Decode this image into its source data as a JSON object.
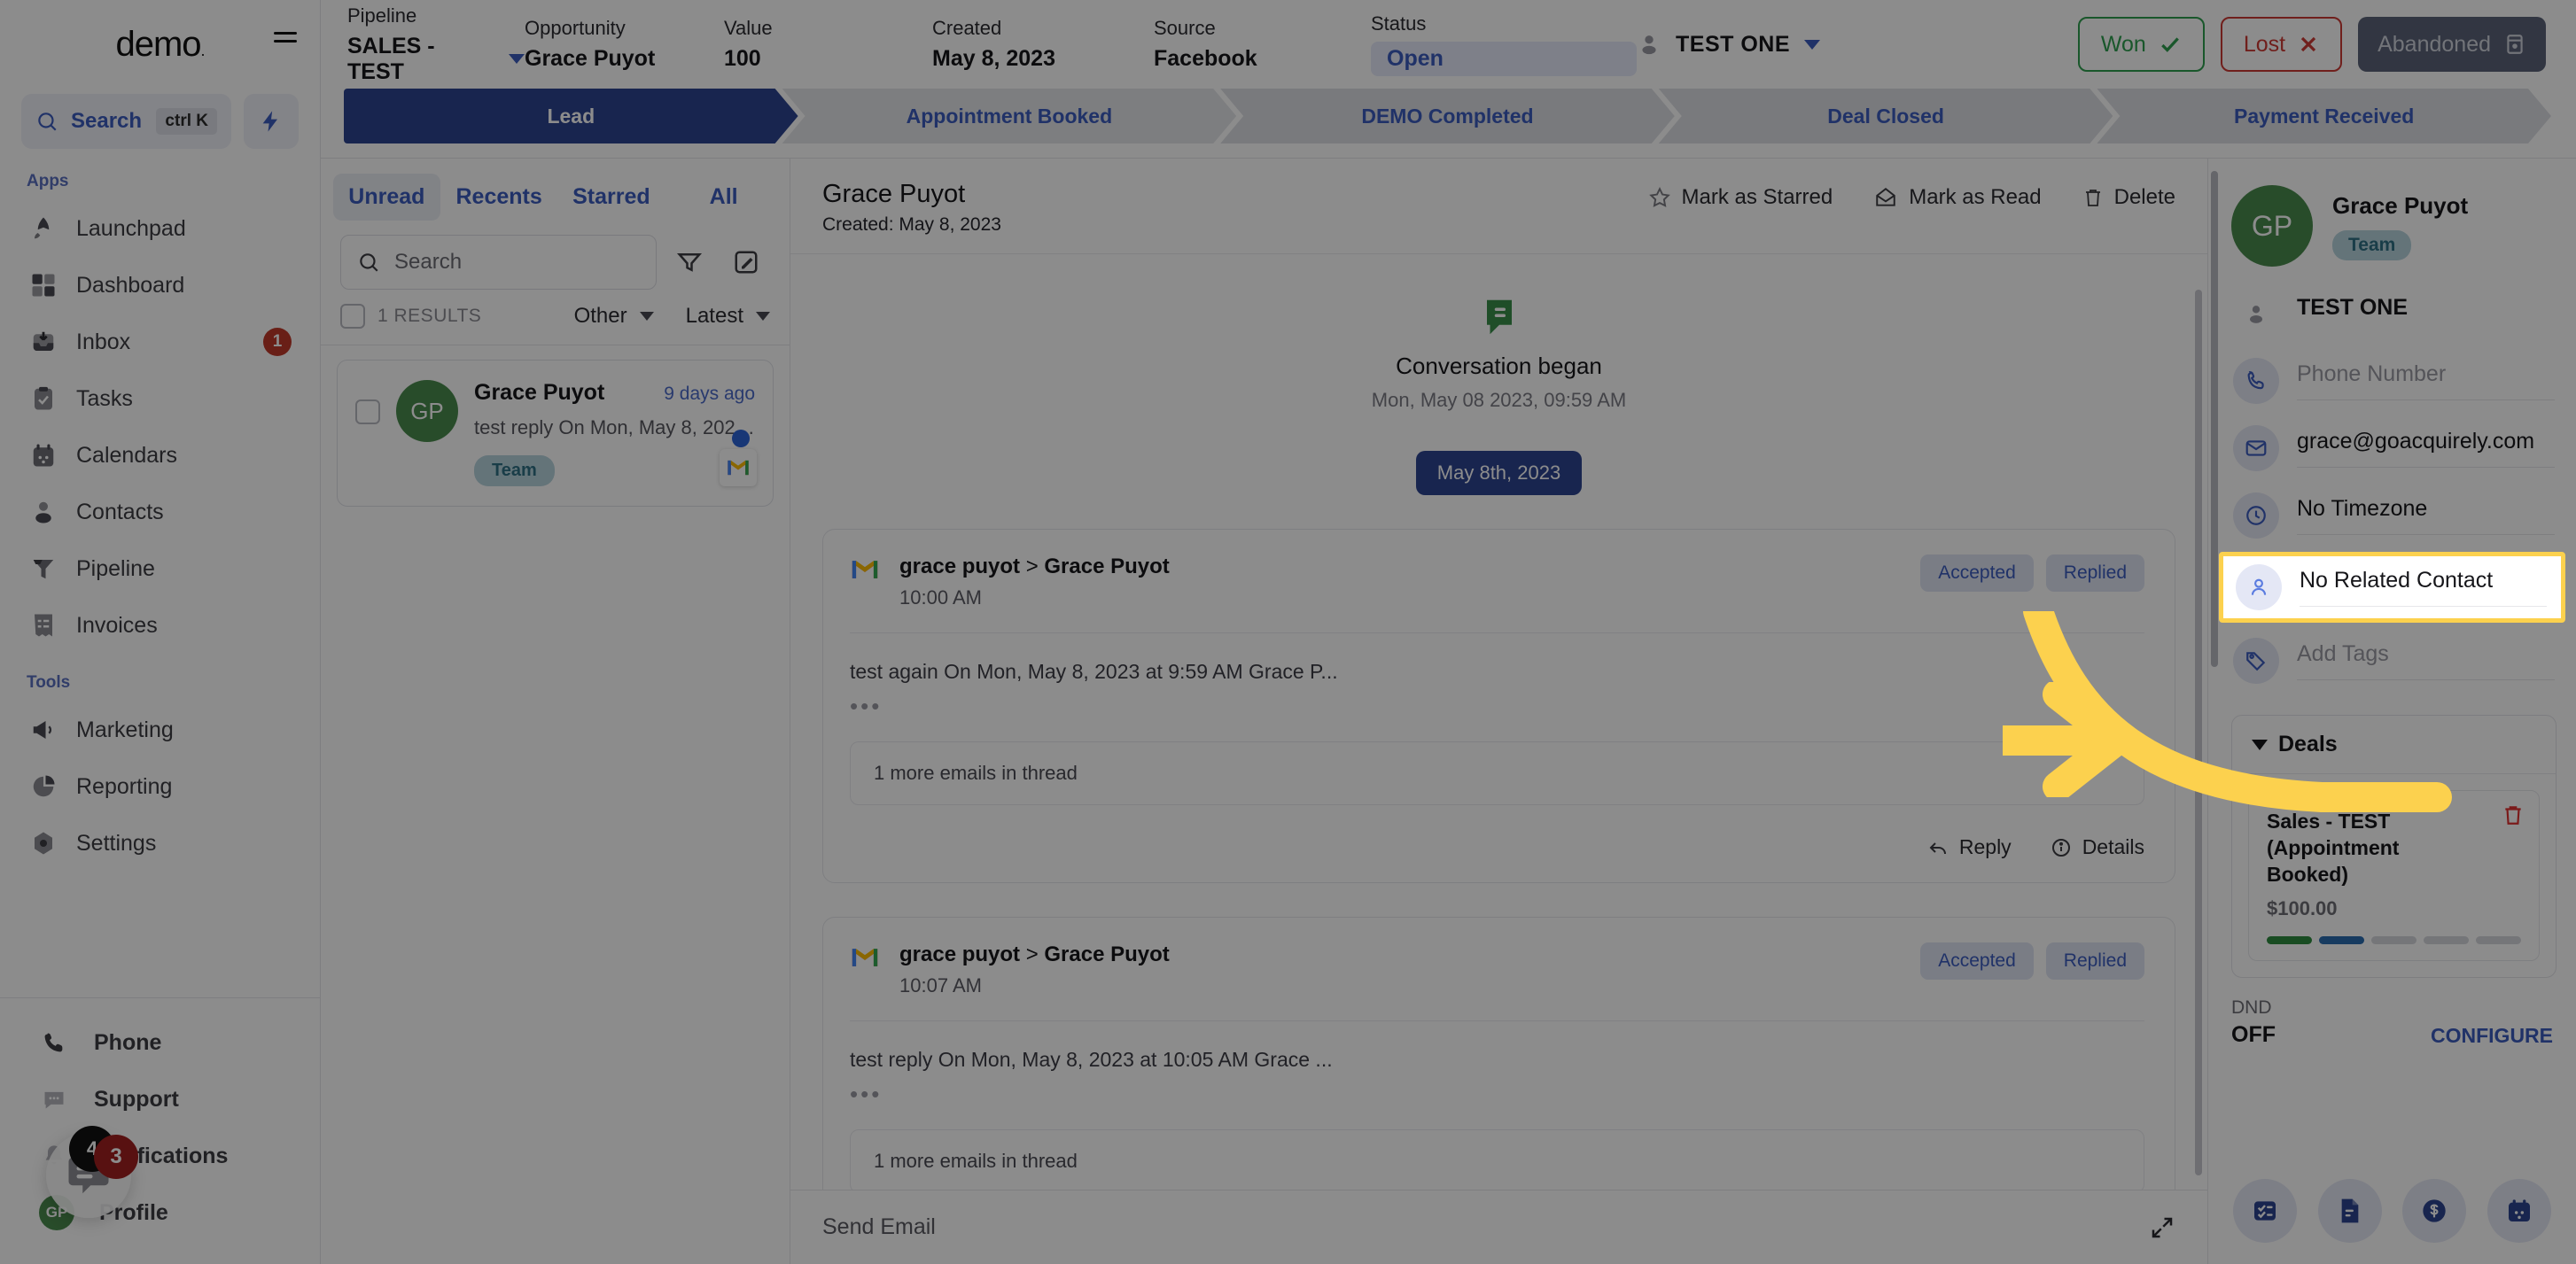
{
  "sidebar": {
    "logo": "demo",
    "search": {
      "label": "Search",
      "shortcut": "ctrl K"
    },
    "sections": [
      {
        "title": "Apps",
        "items": [
          {
            "label": "Launchpad",
            "icon": "rocket-icon",
            "badge": ""
          },
          {
            "label": "Dashboard",
            "icon": "grid-icon",
            "badge": ""
          },
          {
            "label": "Inbox",
            "icon": "inbox-icon",
            "badge": "1"
          },
          {
            "label": "Tasks",
            "icon": "clipboard-check-icon",
            "badge": ""
          },
          {
            "label": "Calendars",
            "icon": "calendar-icon",
            "badge": ""
          },
          {
            "label": "Contacts",
            "icon": "person-icon",
            "badge": ""
          },
          {
            "label": "Pipeline",
            "icon": "funnel-icon",
            "badge": ""
          },
          {
            "label": "Invoices",
            "icon": "invoice-icon",
            "badge": ""
          }
        ]
      },
      {
        "title": "Tools",
        "items": [
          {
            "label": "Marketing",
            "icon": "megaphone-icon",
            "badge": ""
          },
          {
            "label": "Reporting",
            "icon": "pie-chart-icon",
            "badge": ""
          },
          {
            "label": "Settings",
            "icon": "gear-icon",
            "badge": ""
          }
        ]
      }
    ],
    "bottom": [
      {
        "label": "Phone",
        "icon": "phone-icon"
      },
      {
        "label": "Support",
        "icon": "chat-bubble-icon"
      },
      {
        "label": "Notifications",
        "icon": "bell-icon"
      },
      {
        "label": "Profile",
        "icon": "avatar-icon",
        "initials": "GP"
      }
    ],
    "chat_widget": {
      "badge_red": "3",
      "badge_black": "4"
    }
  },
  "topbar": {
    "pipeline": {
      "label": "Pipeline",
      "value": "SALES - TEST"
    },
    "opportunity": {
      "label": "Opportunity",
      "value": "Grace Puyot"
    },
    "value": {
      "label": "Value",
      "value": "100"
    },
    "created": {
      "label": "Created",
      "value": "May 8, 2023"
    },
    "source": {
      "label": "Source",
      "value": "Facebook"
    },
    "status": {
      "label": "Status",
      "value": "Open"
    },
    "owner": "TEST ONE",
    "won": "Won",
    "lost": "Lost",
    "abandoned": "Abandoned"
  },
  "stages": [
    {
      "label": "Lead",
      "active": true
    },
    {
      "label": "Appointment Booked",
      "active": false
    },
    {
      "label": "DEMO Completed",
      "active": false
    },
    {
      "label": "Deal Closed",
      "active": false
    },
    {
      "label": "Payment Received",
      "active": false
    }
  ],
  "conversation_list": {
    "tabs": [
      {
        "label": "Unread",
        "active": true
      },
      {
        "label": "Recents",
        "active": false
      },
      {
        "label": "Starred",
        "active": false
      },
      {
        "label": "All",
        "active": false
      }
    ],
    "search_placeholder": "Search",
    "results_count": "1 RESULTS",
    "filter_type": "Other",
    "sort": "Latest",
    "items": [
      {
        "initials": "GP",
        "name": "Grace Puyot",
        "time": "9 days ago",
        "snippet": "test reply On Mon, May 8, 2023 at …",
        "tag": "Team",
        "channel": "gmail-icon",
        "unread": true
      }
    ]
  },
  "thread": {
    "title": "Grace Puyot",
    "subtitle": "Created: May 8, 2023",
    "actions": [
      {
        "label": "Mark as Starred",
        "icon": "star-icon"
      },
      {
        "label": "Mark as Read",
        "icon": "envelope-open-icon"
      },
      {
        "label": "Delete",
        "icon": "trash-icon"
      }
    ],
    "began_title": "Conversation began",
    "began_sub": "Mon, May 08 2023, 09:59 AM",
    "date_pill": "May 8th, 2023",
    "messages": [
      {
        "channel": "gmail-icon",
        "from_low": "grace puyot",
        "arrow": ">",
        "from_high": "Grace Puyot",
        "time": "10:00 AM",
        "chips": [
          "Accepted",
          "Replied"
        ],
        "body": "test again On Mon, May 8, 2023 at 9:59 AM Grace P...",
        "thread_more": "1 more emails in thread",
        "footer": [
          {
            "label": "Reply",
            "icon": "reply-icon"
          },
          {
            "label": "Details",
            "icon": "info-icon"
          }
        ]
      },
      {
        "channel": "gmail-icon",
        "from_low": "grace puyot",
        "arrow": ">",
        "from_high": "Grace Puyot",
        "time": "10:07 AM",
        "chips": [
          "Accepted",
          "Replied"
        ],
        "body": "test reply On Mon, May 8, 2023 at 10:05 AM Grace ...",
        "thread_more": "1 more emails in thread",
        "footer": []
      }
    ],
    "compose_placeholder": "Send Email"
  },
  "contact": {
    "initials": "GP",
    "name": "Grace Puyot",
    "tag": "Team",
    "owner": "TEST ONE",
    "phone_placeholder": "Phone Number",
    "email": "grace@goacquirely.com",
    "timezone": "No Timezone",
    "related_contact": "No Related Contact",
    "tags_placeholder": "Add Tags",
    "deals": {
      "title": "Deals",
      "items": [
        {
          "name": "Sales - TEST (Appointment Booked)",
          "amount": "$100.00",
          "progress_index": 2
        }
      ]
    },
    "dnd": {
      "label": "DND",
      "value": "OFF",
      "configure": "CONFIGURE"
    },
    "action_icons": [
      "task-icon",
      "document-icon",
      "dollar-icon",
      "calendar-icon"
    ]
  },
  "colors": {
    "accent_blue": "#3b5bbd",
    "stage_active": "#2c4491",
    "avatar_green": "#4a8a4d",
    "highlight_yellow": "#fcd14e",
    "won_green": "#2e9e4f",
    "lost_red": "#cc3a33",
    "badge_red": "#c0392b"
  }
}
